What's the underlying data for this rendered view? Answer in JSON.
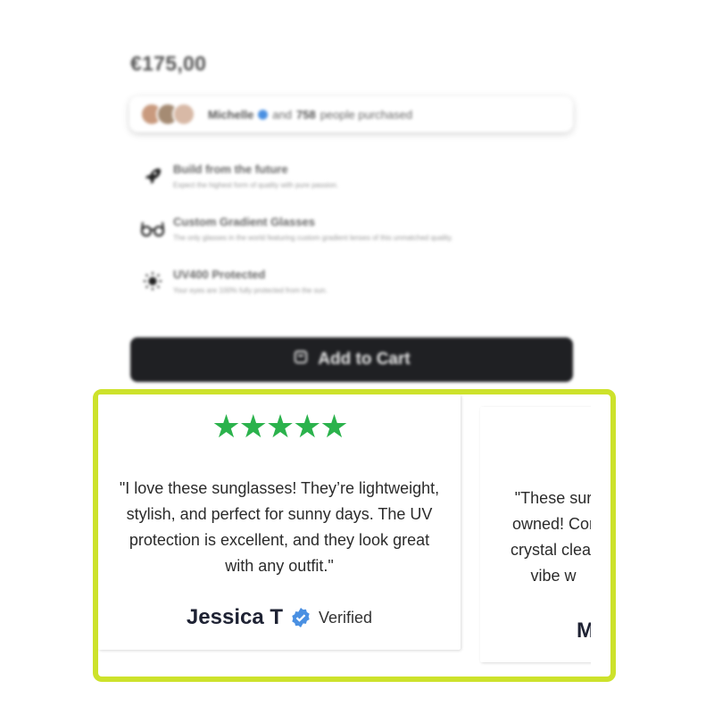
{
  "product": {
    "price": "€175,00",
    "social_proof": {
      "name": "Michelle",
      "connector": "and",
      "count": "758",
      "suffix": "people purchased",
      "avatar_colors": [
        "#c99a7e",
        "#a58b73",
        "#d8b9a6"
      ]
    },
    "features": [
      {
        "icon": "rocket-icon",
        "title": "Build from the future",
        "description": "Expect the highest form of quality with pure passion."
      },
      {
        "icon": "glasses-icon",
        "title": "Custom Gradient Glasses",
        "description": "The only glasses in the world featuring custom gradient lenses of this unmatched quality."
      },
      {
        "icon": "sun-icon",
        "title": "UV400 Protected",
        "description": "Your eyes are 100% fully protected from the sun."
      }
    ],
    "cart_button": {
      "label": "Add to Cart",
      "icon": "bag-icon"
    }
  },
  "reviews": [
    {
      "rating": 5,
      "stars": "★★★★★",
      "quote_lines": [
        "\"I love these sunglasses! They’re lightweight,",
        "stylish, and perfect for sunny days. The UV",
        "protection is excellent, and they look great",
        "with any outfit.\""
      ],
      "author": "Jessica T",
      "badge": "Verified"
    },
    {
      "quote_lines": [
        "\"These sur",
        "owned! Cor",
        "crystal clear",
        "vibe w"
      ],
      "author": "M"
    }
  ],
  "colors": {
    "star": "#2bb24c",
    "highlight_border": "#cde22b",
    "verified_badge": "#4a90e2",
    "button_bg": "#1f2023"
  }
}
